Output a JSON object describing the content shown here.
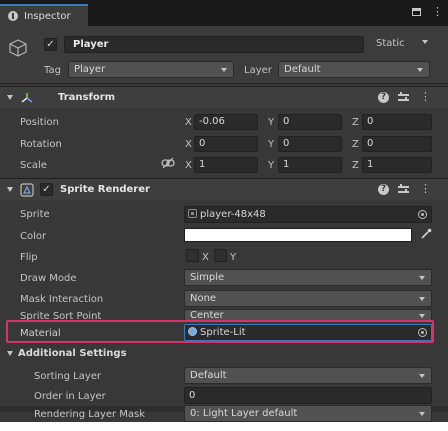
{
  "tab": {
    "title": "Inspector",
    "icon": "info-icon"
  },
  "gameobject": {
    "active": true,
    "name": "Player",
    "static_label": "Static",
    "tag_label": "Tag",
    "tag_value": "Player",
    "layer_label": "Layer",
    "layer_value": "Default"
  },
  "transform": {
    "title": "Transform",
    "position": {
      "label": "Position",
      "x": "-0.06",
      "y": "0",
      "z": "0"
    },
    "rotation": {
      "label": "Rotation",
      "x": "0",
      "y": "0",
      "z": "0"
    },
    "scale": {
      "label": "Scale",
      "x": "1",
      "y": "1",
      "z": "1"
    },
    "axis_x": "X",
    "axis_y": "Y",
    "axis_z": "Z"
  },
  "sprite_renderer": {
    "title": "Sprite Renderer",
    "enabled": true,
    "sprite_label": "Sprite",
    "sprite_value": "player-48x48",
    "color_label": "Color",
    "color_value": "#ffffff",
    "flip_label": "Flip",
    "flip_x": "X",
    "flip_y": "Y",
    "draw_mode_label": "Draw Mode",
    "draw_mode_value": "Simple",
    "mask_label": "Mask Interaction",
    "mask_value": "None",
    "sort_point_label": "Sprite Sort Point",
    "sort_point_value": "Center",
    "material_label": "Material",
    "material_value": "Sprite-Lit",
    "additional_label": "Additional Settings",
    "sorting_layer_label": "Sorting Layer",
    "sorting_layer_value": "Default",
    "order_label": "Order in Layer",
    "order_value": "0",
    "rendering_mask_label": "Rendering Layer Mask",
    "rendering_mask_value": "0: Light Layer default"
  },
  "colors": {
    "highlight": "#d6336c",
    "accent": "#3a79bb"
  }
}
